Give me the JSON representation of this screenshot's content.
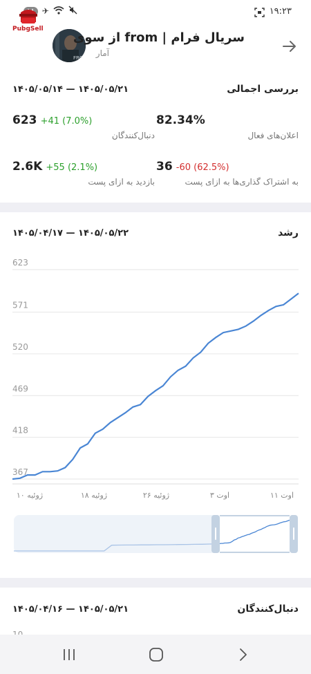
{
  "status_bar": {
    "time": "۱۹:۲۳",
    "badge": "۱۸"
  },
  "logo": {
    "text": "PubgSell"
  },
  "header": {
    "title": "سریال فرام | from از سوی",
    "subtitle": "آمار"
  },
  "overview": {
    "title": "بررسی اجمالی",
    "date_range": "۱۴۰۵/۰۵/۱۴ — ۱۴۰۵/۰۵/۲۱",
    "metrics": [
      {
        "value": "623",
        "delta": "+41 (7.0%)",
        "label": "دنبال‌کنندگان",
        "trend": "up"
      },
      {
        "value": "82.34%",
        "delta": "",
        "label": "اعلان‌های فعال",
        "trend": "none"
      },
      {
        "value": "2.6K",
        "delta": "+55 (2.1%)",
        "label": "بازدید به ازای پست",
        "trend": "up"
      },
      {
        "value": "36",
        "delta": "-60 (62.5%)",
        "label": "به اشتراک گذاری‌ها به ازای پست",
        "trend": "down"
      }
    ]
  },
  "growth": {
    "title": "رشد",
    "date_range": "۱۴۰۵/۰۴/۱۷ — ۱۴۰۵/۰۵/۲۲"
  },
  "followers": {
    "title": "دنبال‌کنندگان",
    "date_range": "۱۴۰۵/۰۴/۱۶ — ۱۴۰۵/۰۵/۲۱",
    "first_tick": "10"
  },
  "colors": {
    "line": "#4a86d4",
    "positive": "#2ca02c",
    "negative": "#d32f2f",
    "separator": "#efeff4"
  },
  "chart_data": {
    "type": "line",
    "title": "رشد",
    "x_tick_labels": [
      "ژوئیه ۱۰",
      "ژوئیه ۱۸",
      "ژوئیه ۲۶",
      "اوت ۳",
      "اوت ۱۱"
    ],
    "y_ticks": [
      367,
      418,
      469,
      520,
      571,
      623
    ],
    "ylim": [
      367,
      623
    ],
    "grid": true,
    "series": [
      {
        "values": [
          367,
          368,
          372,
          372,
          376,
          376,
          377,
          381,
          391,
          405,
          410,
          423,
          428,
          436,
          442,
          448,
          455,
          458,
          468,
          475,
          481,
          492,
          500,
          505,
          515,
          522,
          533,
          540,
          546,
          548,
          550,
          554,
          560,
          567,
          573,
          578,
          580,
          587,
          594
        ]
      }
    ]
  }
}
